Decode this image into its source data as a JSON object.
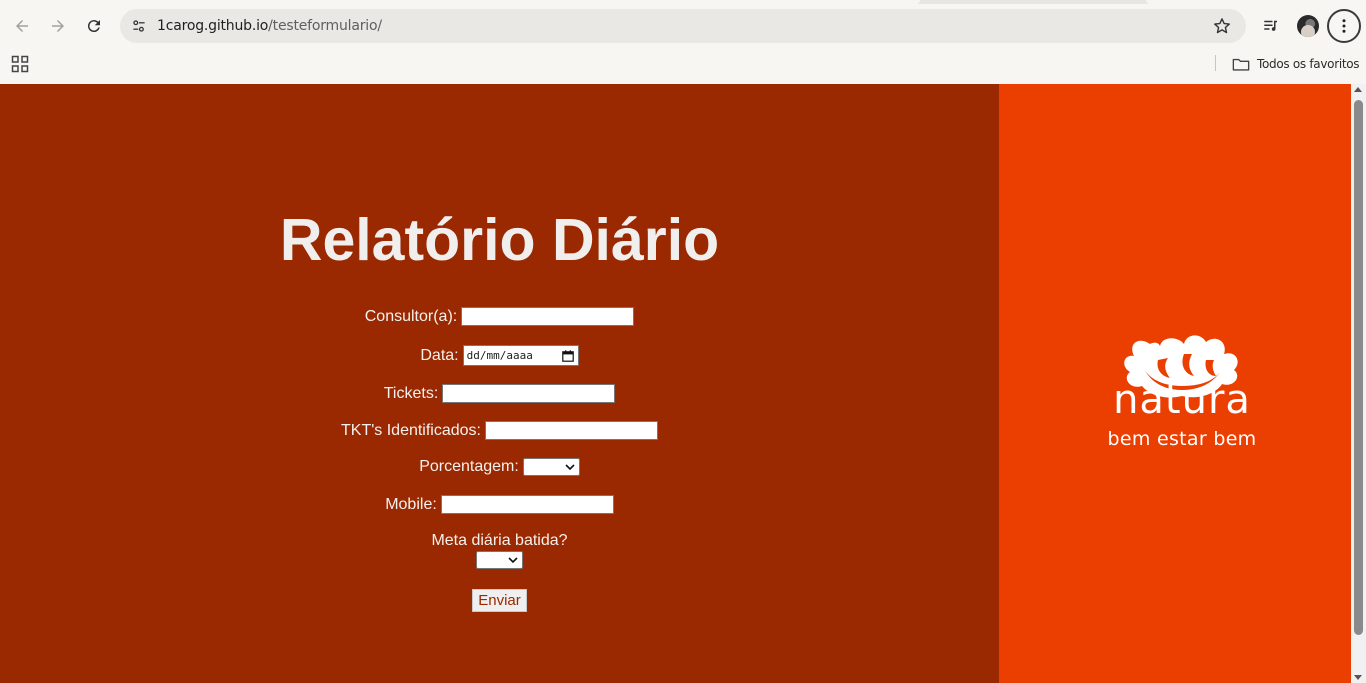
{
  "browser": {
    "url_host": "1carog.github.io",
    "url_path": "/testeformulario/",
    "bookmarks_folder_label": "Todos os favoritos",
    "icons": {
      "back": "arrow-left-icon",
      "forward": "arrow-right-icon",
      "reload": "reload-icon",
      "site_info": "tune-icon",
      "bookmark_star": "star-icon",
      "media": "media-control-icon",
      "menu": "kebab-menu-icon",
      "apps": "apps-grid-icon",
      "folder": "folder-icon"
    }
  },
  "page": {
    "title": "Relatório Diário",
    "fields": {
      "consultor_label": "Consultor(a):",
      "consultor_value": "",
      "data_label": "Data:",
      "data_placeholder": "dd/mm/aaaa",
      "tickets_label": "Tickets:",
      "tickets_value": "",
      "tkt_label": "TKT's Identificados:",
      "tkt_value": "",
      "porcentagem_label": "Porcentagem:",
      "porcentagem_selected": "",
      "mobile_label": "Mobile:",
      "mobile_value": "",
      "meta_label": "Meta diária batida?",
      "meta_selected": ""
    },
    "submit_label": "Enviar"
  },
  "brand": {
    "logo_word": "natura",
    "tagline": "bem estar bem"
  },
  "colors": {
    "left_panel": "#9a2800",
    "right_panel": "#ea3f00",
    "text_light": "#f5f1ee"
  }
}
